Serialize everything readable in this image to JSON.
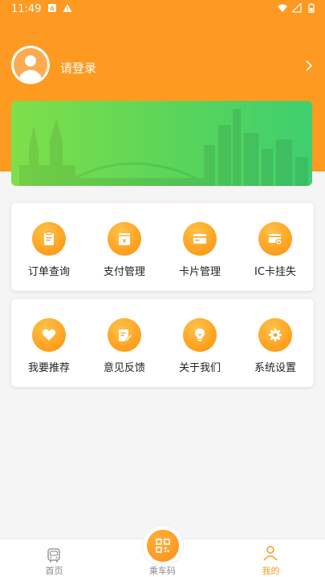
{
  "status_bar": {
    "time": "11:49"
  },
  "profile": {
    "login_text": "请登录"
  },
  "menu_card_1": [
    {
      "label": "订单查询",
      "icon": "clipboard-icon"
    },
    {
      "label": "支付管理",
      "icon": "yen-wallet-icon"
    },
    {
      "label": "卡片管理",
      "icon": "card-icon"
    },
    {
      "label": "IC卡挂失",
      "icon": "card-lock-icon"
    }
  ],
  "menu_card_2": [
    {
      "label": "我要推荐",
      "icon": "heart-icon"
    },
    {
      "label": "意见反馈",
      "icon": "feedback-edit-icon"
    },
    {
      "label": "关于我们",
      "icon": "lightbulb-icon"
    },
    {
      "label": "系统设置",
      "icon": "gear-icon"
    }
  ],
  "bottom_nav": {
    "home": "首页",
    "code": "乘车码",
    "mine": "我的"
  },
  "colors": {
    "primary": "#fe9a22",
    "banner_green": "#57d45c"
  }
}
